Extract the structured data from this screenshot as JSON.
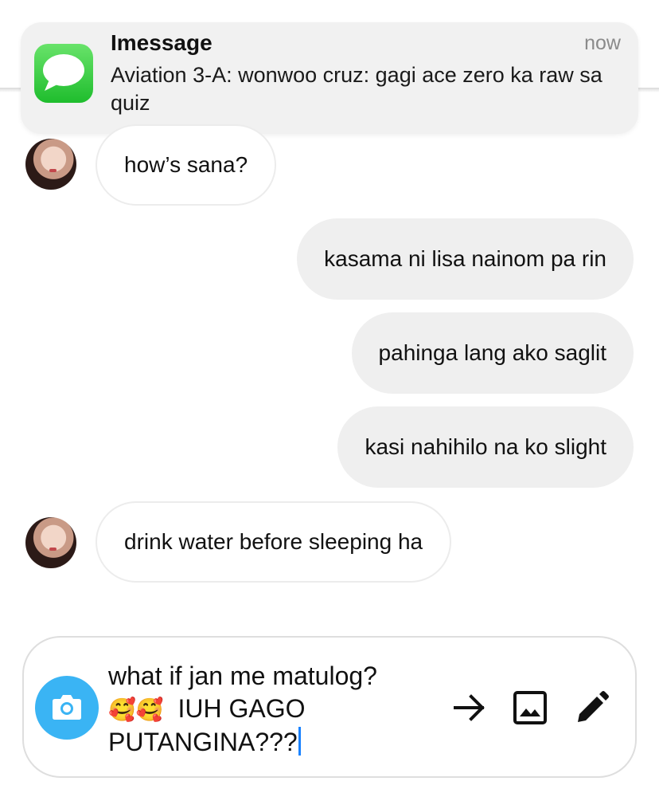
{
  "notification": {
    "app_name": "Imessage",
    "time": "now",
    "body": "Aviation 3-A: wonwoo cruz: gagi ace zero ka raw sa quiz",
    "icon": "messages-app-icon"
  },
  "messages": [
    {
      "direction": "incoming",
      "text": "how’s sana?"
    },
    {
      "direction": "outgoing",
      "text": "kasama ni lisa nainom pa rin"
    },
    {
      "direction": "outgoing",
      "text": "pahinga lang ako saglit"
    },
    {
      "direction": "outgoing",
      "text": "kasi nahihilo na ko slight"
    },
    {
      "direction": "incoming",
      "text": "drink water before sleeping ha"
    }
  ],
  "composer": {
    "line1": "what if jan me matulog?",
    "emojis": "🥰🥰",
    "line2": "IUH GAGO",
    "line3": "PUTANGINA???",
    "icons": [
      "camera-icon",
      "send-arrow-icon",
      "gallery-icon",
      "pencil-icon"
    ]
  },
  "colors": {
    "camera_button": "#3ab4f4",
    "incoming_bubble": "#ffffff",
    "outgoing_bubble": "#efefef",
    "caret": "#1a83ff"
  }
}
